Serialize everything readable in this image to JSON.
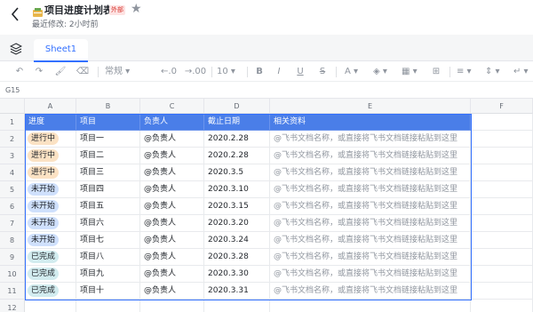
{
  "document": {
    "title": "项目进度计划表",
    "external_badge": "外部",
    "last_modified": "最近修改: 2小时前"
  },
  "sheets": {
    "tabs": [
      {
        "label": "Sheet1"
      }
    ]
  },
  "toolbar": {
    "format_label": "常规",
    "decimal_decrease": ".0",
    "decimal_increase": ".00",
    "font_size": "10",
    "bold": "B",
    "italic": "I",
    "underline": "U",
    "strikethrough": "S",
    "font_color": "A"
  },
  "formula_bar": {
    "cell_ref": "G15"
  },
  "columns": [
    "A",
    "B",
    "C",
    "D",
    "E",
    "F"
  ],
  "header_row": {
    "number": "1",
    "status": "进度",
    "project": "项目",
    "owner": "负责人",
    "deadline": "截止日期",
    "docs": "相关资料"
  },
  "rows": [
    {
      "number": "2",
      "status": "进行中",
      "status_color": "#fbe2c4",
      "status_text_color": "#1f2329",
      "project": "项目一",
      "owner": "@负责人",
      "deadline": "2020.2.28",
      "docs": "@飞书文档名称，或直接将飞书文档链接粘贴到这里"
    },
    {
      "number": "3",
      "status": "进行中",
      "status_color": "#fbe2c4",
      "status_text_color": "#1f2329",
      "project": "项目二",
      "owner": "@负责人",
      "deadline": "2020.2.28",
      "docs": "@飞书文档名称，或直接将飞书文档链接粘贴到这里"
    },
    {
      "number": "4",
      "status": "进行中",
      "status_color": "#fbe2c4",
      "status_text_color": "#1f2329",
      "project": "项目三",
      "owner": "@负责人",
      "deadline": "2020.3.5",
      "docs": "@飞书文档名称，或直接将飞书文档链接粘贴到这里"
    },
    {
      "number": "5",
      "status": "未开始",
      "status_color": "#cfe0fc",
      "status_text_color": "#1f2329",
      "project": "项目四",
      "owner": "@负责人",
      "deadline": "2020.3.10",
      "docs": "@飞书文档名称，或直接将飞书文档链接粘贴到这里"
    },
    {
      "number": "6",
      "status": "未开始",
      "status_color": "#cfe0fc",
      "status_text_color": "#1f2329",
      "project": "项目五",
      "owner": "@负责人",
      "deadline": "2020.3.15",
      "docs": "@飞书文档名称，或直接将飞书文档链接粘贴到这里"
    },
    {
      "number": "7",
      "status": "未开始",
      "status_color": "#cfe0fc",
      "status_text_color": "#1f2329",
      "project": "项目六",
      "owner": "@负责人",
      "deadline": "2020.3.20",
      "docs": "@飞书文档名称，或直接将飞书文档链接粘贴到这里"
    },
    {
      "number": "8",
      "status": "未开始",
      "status_color": "#cfe0fc",
      "status_text_color": "#1f2329",
      "project": "项目七",
      "owner": "@负责人",
      "deadline": "2020.3.24",
      "docs": "@飞书文档名称，或直接将飞书文档链接粘贴到这里"
    },
    {
      "number": "9",
      "status": "已完成",
      "status_color": "#d2ecef",
      "status_text_color": "#1f2329",
      "project": "项目八",
      "owner": "@负责人",
      "deadline": "2020.3.28",
      "docs": "@飞书文档名称，或直接将飞书文档链接粘贴到这里"
    },
    {
      "number": "10",
      "status": "已完成",
      "status_color": "#d2ecef",
      "status_text_color": "#1f2329",
      "project": "项目九",
      "owner": "@负责人",
      "deadline": "2020.3.30",
      "docs": "@飞书文档名称，或直接将飞书文档链接粘贴到这里"
    },
    {
      "number": "11",
      "status": "已完成",
      "status_color": "#d2ecef",
      "status_text_color": "#1f2329",
      "project": "项目十",
      "owner": "@负责人",
      "deadline": "2020.3.31",
      "docs": "@飞书文档名称，或直接将飞书文档链接粘贴到这里"
    },
    {
      "number": "12",
      "status": "",
      "status_color": "",
      "status_text_color": "",
      "project": "",
      "owner": "",
      "deadline": "",
      "docs": ""
    }
  ],
  "colors": {
    "accent": "#3370ff",
    "header_fill": "#4a7ee8"
  }
}
